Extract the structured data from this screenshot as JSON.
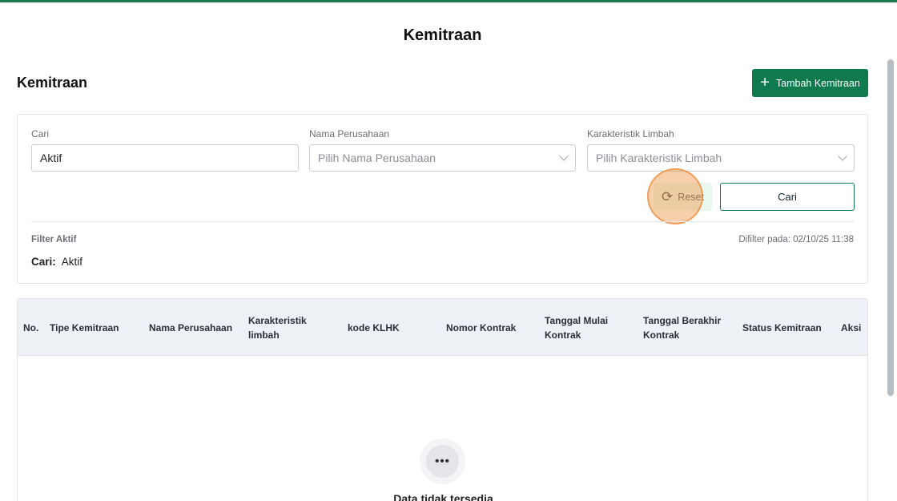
{
  "page": {
    "title": "Kemitraan"
  },
  "header": {
    "section_title": "Kemitraan",
    "add_button_label": "Tambah Kemitraan"
  },
  "filters": {
    "search_label": "Cari",
    "search_value": "Aktif",
    "company_label": "Nama Perusahaan",
    "company_placeholder": "Pilih Nama Perusahaan",
    "waste_label": "Karakteristik Limbah",
    "waste_placeholder": "Pilih Karakteristik Limbah",
    "reset_label": "Reset",
    "search_button_label": "Cari",
    "active_filter_title": "Filter Aktif",
    "filtered_at": "Difilter pada: 02/10/25 11:38",
    "active_chip_key": "Cari:",
    "active_chip_value": "Aktif"
  },
  "table": {
    "columns": [
      "No.",
      "Tipe Kemitraan",
      "Nama Perusahaan",
      "Karakteristik limbah",
      "kode KLHK",
      "Nomor Kontrak",
      "Tanggal Mulai Kontrak",
      "Tanggal Berakhir Kontrak",
      "Status Kemitraan",
      "Aksi"
    ],
    "empty_icon": "ellipsis-icon",
    "empty_text": "Data tidak tersedia"
  },
  "colors": {
    "primary": "#0e7a4e",
    "header_bg": "#eef1f6",
    "reset_bg": "#e9f7ef"
  }
}
